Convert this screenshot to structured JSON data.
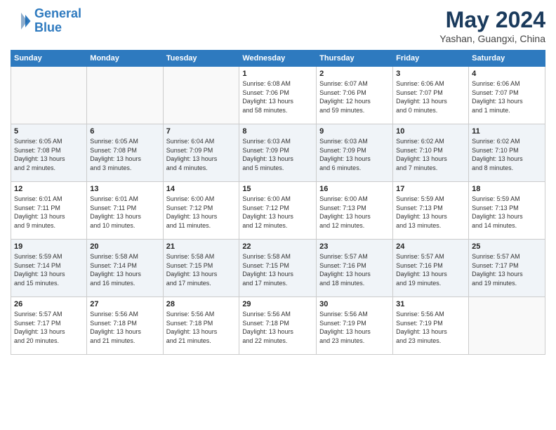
{
  "header": {
    "logo_line1": "General",
    "logo_line2": "Blue",
    "month": "May 2024",
    "location": "Yashan, Guangxi, China"
  },
  "weekdays": [
    "Sunday",
    "Monday",
    "Tuesday",
    "Wednesday",
    "Thursday",
    "Friday",
    "Saturday"
  ],
  "weeks": [
    [
      {
        "day": "",
        "info": ""
      },
      {
        "day": "",
        "info": ""
      },
      {
        "day": "",
        "info": ""
      },
      {
        "day": "1",
        "info": "Sunrise: 6:08 AM\nSunset: 7:06 PM\nDaylight: 13 hours\nand 58 minutes."
      },
      {
        "day": "2",
        "info": "Sunrise: 6:07 AM\nSunset: 7:06 PM\nDaylight: 12 hours\nand 59 minutes."
      },
      {
        "day": "3",
        "info": "Sunrise: 6:06 AM\nSunset: 7:07 PM\nDaylight: 13 hours\nand 0 minutes."
      },
      {
        "day": "4",
        "info": "Sunrise: 6:06 AM\nSunset: 7:07 PM\nDaylight: 13 hours\nand 1 minute."
      }
    ],
    [
      {
        "day": "5",
        "info": "Sunrise: 6:05 AM\nSunset: 7:08 PM\nDaylight: 13 hours\nand 2 minutes."
      },
      {
        "day": "6",
        "info": "Sunrise: 6:05 AM\nSunset: 7:08 PM\nDaylight: 13 hours\nand 3 minutes."
      },
      {
        "day": "7",
        "info": "Sunrise: 6:04 AM\nSunset: 7:09 PM\nDaylight: 13 hours\nand 4 minutes."
      },
      {
        "day": "8",
        "info": "Sunrise: 6:03 AM\nSunset: 7:09 PM\nDaylight: 13 hours\nand 5 minutes."
      },
      {
        "day": "9",
        "info": "Sunrise: 6:03 AM\nSunset: 7:09 PM\nDaylight: 13 hours\nand 6 minutes."
      },
      {
        "day": "10",
        "info": "Sunrise: 6:02 AM\nSunset: 7:10 PM\nDaylight: 13 hours\nand 7 minutes."
      },
      {
        "day": "11",
        "info": "Sunrise: 6:02 AM\nSunset: 7:10 PM\nDaylight: 13 hours\nand 8 minutes."
      }
    ],
    [
      {
        "day": "12",
        "info": "Sunrise: 6:01 AM\nSunset: 7:11 PM\nDaylight: 13 hours\nand 9 minutes."
      },
      {
        "day": "13",
        "info": "Sunrise: 6:01 AM\nSunset: 7:11 PM\nDaylight: 13 hours\nand 10 minutes."
      },
      {
        "day": "14",
        "info": "Sunrise: 6:00 AM\nSunset: 7:12 PM\nDaylight: 13 hours\nand 11 minutes."
      },
      {
        "day": "15",
        "info": "Sunrise: 6:00 AM\nSunset: 7:12 PM\nDaylight: 13 hours\nand 12 minutes."
      },
      {
        "day": "16",
        "info": "Sunrise: 6:00 AM\nSunset: 7:13 PM\nDaylight: 13 hours\nand 12 minutes."
      },
      {
        "day": "17",
        "info": "Sunrise: 5:59 AM\nSunset: 7:13 PM\nDaylight: 13 hours\nand 13 minutes."
      },
      {
        "day": "18",
        "info": "Sunrise: 5:59 AM\nSunset: 7:13 PM\nDaylight: 13 hours\nand 14 minutes."
      }
    ],
    [
      {
        "day": "19",
        "info": "Sunrise: 5:59 AM\nSunset: 7:14 PM\nDaylight: 13 hours\nand 15 minutes."
      },
      {
        "day": "20",
        "info": "Sunrise: 5:58 AM\nSunset: 7:14 PM\nDaylight: 13 hours\nand 16 minutes."
      },
      {
        "day": "21",
        "info": "Sunrise: 5:58 AM\nSunset: 7:15 PM\nDaylight: 13 hours\nand 17 minutes."
      },
      {
        "day": "22",
        "info": "Sunrise: 5:58 AM\nSunset: 7:15 PM\nDaylight: 13 hours\nand 17 minutes."
      },
      {
        "day": "23",
        "info": "Sunrise: 5:57 AM\nSunset: 7:16 PM\nDaylight: 13 hours\nand 18 minutes."
      },
      {
        "day": "24",
        "info": "Sunrise: 5:57 AM\nSunset: 7:16 PM\nDaylight: 13 hours\nand 19 minutes."
      },
      {
        "day": "25",
        "info": "Sunrise: 5:57 AM\nSunset: 7:17 PM\nDaylight: 13 hours\nand 19 minutes."
      }
    ],
    [
      {
        "day": "26",
        "info": "Sunrise: 5:57 AM\nSunset: 7:17 PM\nDaylight: 13 hours\nand 20 minutes."
      },
      {
        "day": "27",
        "info": "Sunrise: 5:56 AM\nSunset: 7:18 PM\nDaylight: 13 hours\nand 21 minutes."
      },
      {
        "day": "28",
        "info": "Sunrise: 5:56 AM\nSunset: 7:18 PM\nDaylight: 13 hours\nand 21 minutes."
      },
      {
        "day": "29",
        "info": "Sunrise: 5:56 AM\nSunset: 7:18 PM\nDaylight: 13 hours\nand 22 minutes."
      },
      {
        "day": "30",
        "info": "Sunrise: 5:56 AM\nSunset: 7:19 PM\nDaylight: 13 hours\nand 23 minutes."
      },
      {
        "day": "31",
        "info": "Sunrise: 5:56 AM\nSunset: 7:19 PM\nDaylight: 13 hours\nand 23 minutes."
      },
      {
        "day": "",
        "info": ""
      }
    ]
  ]
}
